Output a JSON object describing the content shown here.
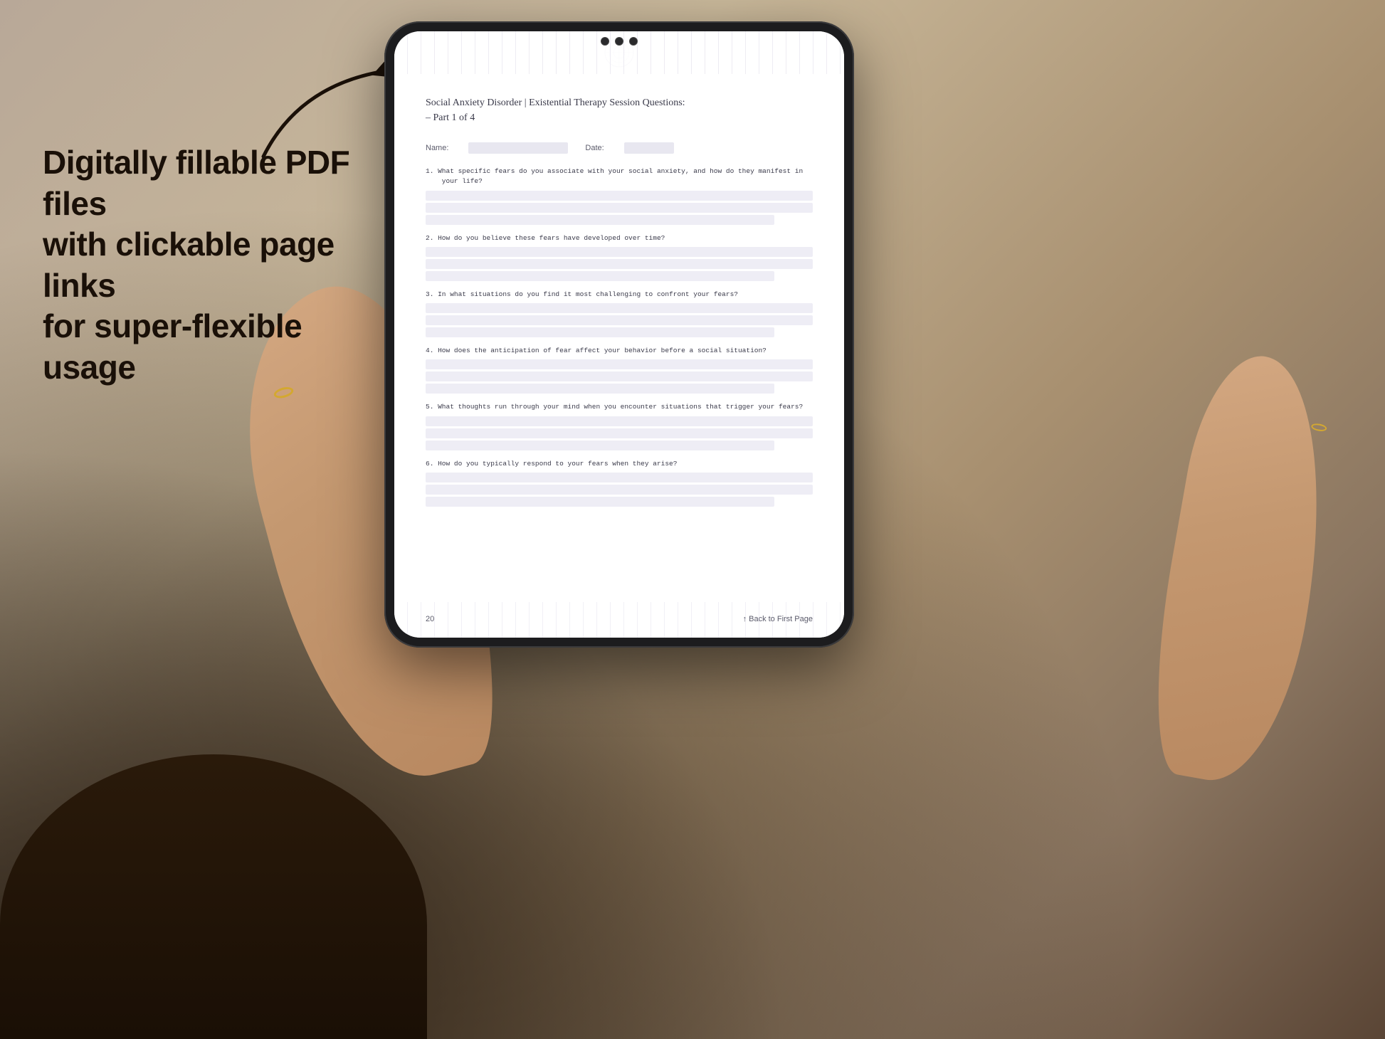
{
  "background": {
    "color_start": "#b8a898",
    "color_end": "#5a4535"
  },
  "left_panel": {
    "tagline": "Digitally fillable PDF files\nwith clickable page links\nfor super-flexible usage"
  },
  "arrow": {
    "description": "curved arrow pointing right toward tablet"
  },
  "tablet": {
    "camera_dots": 3
  },
  "pdf": {
    "title_line1": "Social Anxiety Disorder | Existential Therapy Session Questions:",
    "title_line2": "– Part 1 of 4",
    "part_label": "Part 1 of",
    "part_number": "4",
    "name_label": "Name:",
    "date_label": "Date:",
    "questions": [
      {
        "number": "1.",
        "text": "What specific fears do you associate with your social anxiety, and how do they manifest in\n    your life?",
        "answer_lines": 3
      },
      {
        "number": "2.",
        "text": "How do you believe these fears have developed over time?",
        "answer_lines": 3
      },
      {
        "number": "3.",
        "text": "In what situations do you find it most challenging to confront your fears?",
        "answer_lines": 3
      },
      {
        "number": "4.",
        "text": "How does the anticipation of fear affect your behavior before a social situation?",
        "answer_lines": 3
      },
      {
        "number": "5.",
        "text": "What thoughts run through your mind when you encounter situations that trigger your fears?",
        "answer_lines": 3
      },
      {
        "number": "6.",
        "text": "How do you typically respond to your fears when they arise?",
        "answer_lines": 3
      }
    ],
    "footer": {
      "page_number": "20",
      "back_link": "↑ Back to First Page"
    }
  }
}
